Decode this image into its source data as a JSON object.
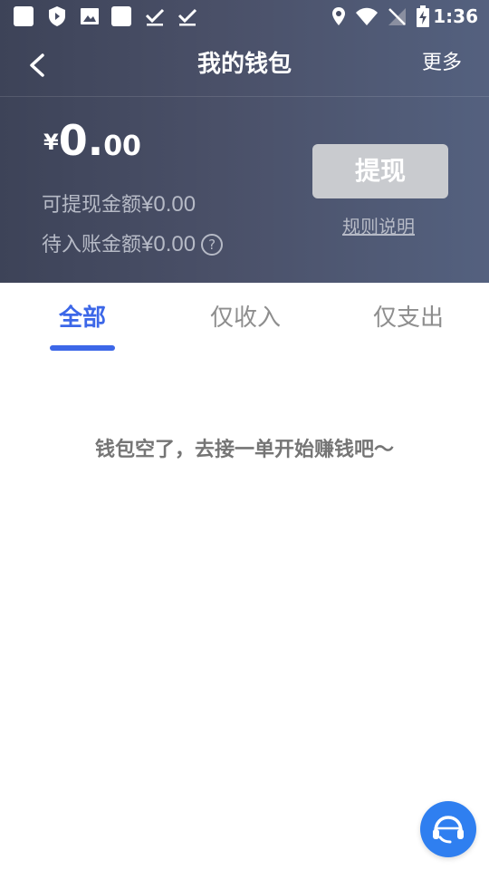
{
  "status_bar": {
    "time": "1:36",
    "left_icons": [
      "app-icon",
      "shield-icon",
      "image-icon",
      "app-icon",
      "download-done-icon",
      "download-done-icon"
    ],
    "right_icons": [
      "location-icon",
      "wifi-icon",
      "no-signal-icon",
      "battery-charging-icon"
    ]
  },
  "nav": {
    "title": "我的钱包",
    "more_label": "更多",
    "back_icon": "chevron-left-icon"
  },
  "balance": {
    "currency": "¥",
    "integer": "0.",
    "decimal": "00"
  },
  "info": {
    "withdrawable_label": "可提现金额",
    "withdrawable_amount": "¥0.00",
    "pending_label": "待入账金额",
    "pending_amount": "¥0.00",
    "help_icon": "question-circle-icon"
  },
  "actions": {
    "withdraw_label": "提现",
    "rules_label": "规则说明"
  },
  "tabs": [
    {
      "label": "全部",
      "active": true
    },
    {
      "label": "仅收入",
      "active": false
    },
    {
      "label": "仅支出",
      "active": false
    }
  ],
  "empty_state": {
    "message": "钱包空了，去接一单开始赚钱吧～"
  },
  "floating": {
    "icon": "headset-service-icon"
  },
  "colors": {
    "accent": "#3c67e8",
    "header_start": "#3d4358",
    "header_end": "#54617f",
    "button_disabled": "#c9cbcf",
    "service_button": "#2f7ff0"
  }
}
